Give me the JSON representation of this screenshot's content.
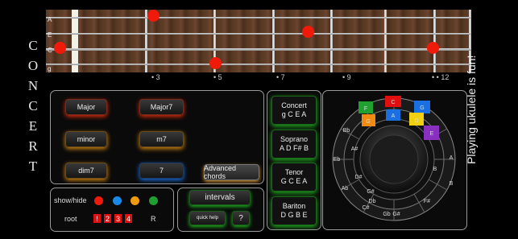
{
  "side_title": [
    "C",
    "O",
    "N",
    "C",
    "E",
    "R",
    "T"
  ],
  "strings": [
    "A",
    "E",
    "C",
    "g"
  ],
  "fret_markers": [
    "3",
    "5",
    "7",
    "9",
    "12"
  ],
  "chords": {
    "major": "Major",
    "major7": "Major7",
    "minor": "minor",
    "m7": "m7",
    "dim7": "dim7",
    "seven": "7",
    "advanced": "Advanced chords"
  },
  "tunings": [
    {
      "name": "Concert",
      "notes": "g C E A"
    },
    {
      "name": "Soprano",
      "notes": "A D F# B"
    },
    {
      "name": "Tenor",
      "notes": "G C E A"
    },
    {
      "name": "Bariton",
      "notes": "D G B E"
    }
  ],
  "controls": {
    "show_hide": "show/hide",
    "root": "root",
    "root_boxes": [
      "!",
      "2",
      "3",
      "4"
    ],
    "root_suffix": "R",
    "intervals": "intervals",
    "quick_help": "quick help",
    "help": "?"
  },
  "wheel": {
    "outer_notes": [
      "F",
      "C",
      "G",
      "D",
      "A",
      "E",
      "B",
      "F#",
      "C#",
      "G#",
      "D#",
      "A#"
    ],
    "mid_notes": [
      "Bb",
      "Eb",
      "Ab",
      "Db",
      "Gb"
    ],
    "colored": [
      {
        "note": "F",
        "color": "#20a030"
      },
      {
        "note": "C",
        "color": "#e01010"
      },
      {
        "note": "G",
        "color": "#1a70e0"
      },
      {
        "note": "D",
        "color": "#f0d010"
      },
      {
        "note": "A",
        "color": "#8a30c0"
      },
      {
        "note": "G",
        "color": "#f08a10"
      }
    ]
  },
  "tagline": "Playing ukulele is fun!",
  "colors": {
    "red": "#f01a0a",
    "blue": "#1a8ae8",
    "orange": "#f09a10",
    "green": "#20a030"
  }
}
